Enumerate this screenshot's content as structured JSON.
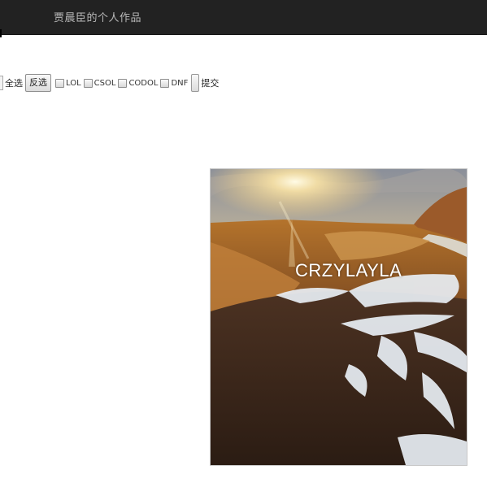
{
  "header": {
    "title": "贾晨臣的个人作品"
  },
  "form": {
    "select_all_label": "全选",
    "invert_button_label": "反选",
    "options": [
      "LOL",
      "CSOL",
      "CODOL",
      "DNF"
    ],
    "submit_label": "提交"
  },
  "photo": {
    "caption": "CRZYLAYLA"
  },
  "colors": {
    "header_bg": "#222222",
    "header_text": "#b9b9b9"
  }
}
